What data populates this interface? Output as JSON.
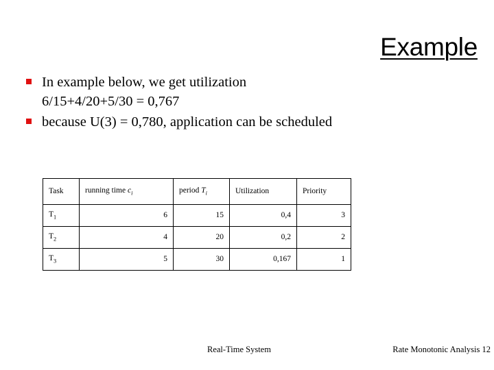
{
  "slide": {
    "title": "Example"
  },
  "body": {
    "bullets": [
      {
        "marker": "red-square-bullet",
        "lines": [
          "In example below, we get utilization",
          "6/15+4/20+5/30 = 0,767"
        ]
      },
      {
        "marker": "red-square-bullet",
        "lines": [
          "because U(3) = 0,780, application can be scheduled"
        ]
      }
    ]
  },
  "table": {
    "headers": {
      "task": "Task",
      "running_time_label": "running time ",
      "running_time_var": "c",
      "running_time_sub": "i",
      "period_label": "period ",
      "period_var": "T",
      "period_sub": "i",
      "utilization": "Utilization",
      "priority": "Priority"
    },
    "rows": [
      {
        "task_name": "T",
        "task_sub": "1",
        "running_time": "6",
        "period": "15",
        "utilization": "0,4",
        "priority": "3"
      },
      {
        "task_name": "T",
        "task_sub": "2",
        "running_time": "4",
        "period": "20",
        "utilization": "0,2",
        "priority": "2"
      },
      {
        "task_name": "T",
        "task_sub": "3",
        "running_time": "5",
        "period": "30",
        "utilization": "0,167",
        "priority": "1"
      }
    ]
  },
  "footer": {
    "center": "Real-Time System",
    "right": "Rate Monotonic Analysis 12"
  },
  "colors": {
    "bullet_marker": "#e01010",
    "text": "#000000",
    "background": "#ffffff",
    "table_border": "#000000"
  }
}
